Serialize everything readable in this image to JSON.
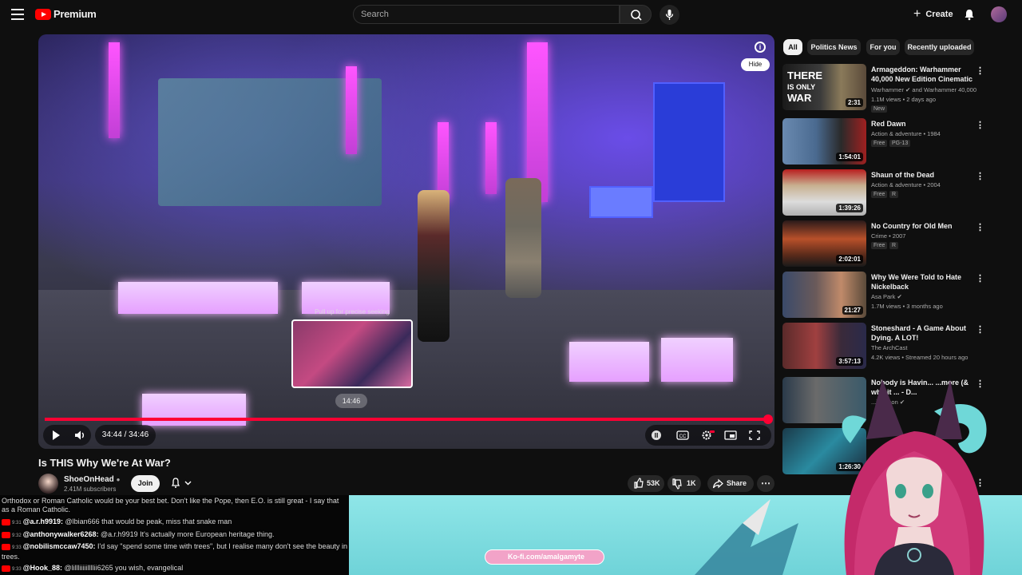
{
  "topbar": {
    "logo_text": "Premium",
    "search_placeholder": "Search",
    "create_label": "Create"
  },
  "player": {
    "preview_label": "Pull up for precise seeking",
    "preview_time": "14:46",
    "hide_label": "Hide",
    "time_display": "34:44 / 34:46",
    "progress_fraction": 0.999
  },
  "video": {
    "title": "Is THIS Why We're At War?",
    "channel_name": "ShoeOnHead",
    "subscribers": "2.41M subscribers",
    "join_label": "Join",
    "likes": "53K",
    "dislikes": "1K",
    "share_label": "Share"
  },
  "chips": [
    "All",
    "Politics News",
    "For you",
    "Recently uploaded"
  ],
  "recommendations": [
    {
      "title": "Armageddon: Warhammer 40,000 New Edition Cinematic ...",
      "meta1": "Warhammer ✔ and Warhammer 40,000",
      "meta2": "1.1M views • 2 days ago",
      "badge": "New",
      "duration": "2:31"
    },
    {
      "title": "Red Dawn",
      "meta1": "Action & adventure • 1984",
      "badge": "Free",
      "badge2": "PG-13",
      "duration": "1:54:01"
    },
    {
      "title": "Shaun of the Dead",
      "meta1": "Action & adventure • 2004",
      "badge": "Free",
      "badge2": "R",
      "duration": "1:39:26"
    },
    {
      "title": "No Country for Old Men",
      "meta1": "Crime • 2007",
      "badge": "Free",
      "badge2": "R",
      "duration": "2:02:01"
    },
    {
      "title": "Why We Were Told to Hate Nickelback",
      "meta1": "Asa Park ✔",
      "meta2": "1.7M views • 3 months ago",
      "duration": "21:27"
    },
    {
      "title": "Stoneshard - A Game About Dying. A LOT!",
      "meta1": "The ArchCast",
      "meta2": "4.2K views • Streamed 20 hours ago",
      "duration": "3:57:13"
    },
    {
      "title": "Nobody is Havin... ...more (& why it ... - D...",
      "meta1": "...illamson ✔",
      "duration": ""
    },
    {
      "title": "",
      "meta1": "",
      "duration": "1:26:30"
    }
  ],
  "chat": [
    {
      "user": "",
      "text": "Orthodox or Roman Catholic would be your best bet. Don't like the Pope, then E.O. is still great - I say that as a Roman Catholic."
    },
    {
      "time": "9:31",
      "user": "@a.r.h9919:",
      "text": "@lbian666 that would be peak, miss that snake man"
    },
    {
      "time": "9:32",
      "user": "@anthonywalker6268:",
      "text": "@a.r.h9919 It's actually more European heritage thing."
    },
    {
      "time": "9:33",
      "user": "@nobilismccaw7450:",
      "text": "I'd say \"spend some time with trees\", but I realise many don't see the beauty in trees."
    },
    {
      "time": "9:33",
      "user": "@Hook_88:",
      "text": "@lillliiiiillllii6265 you wish, evangelical"
    }
  ],
  "overlay": {
    "kofi_text": "Ko-fi.com/amalgamyte"
  },
  "colors": {
    "accent": "#ff0033",
    "background": "#0f0f0f",
    "banner": "#8fe6e8",
    "kofi": "#f2a3c8"
  }
}
